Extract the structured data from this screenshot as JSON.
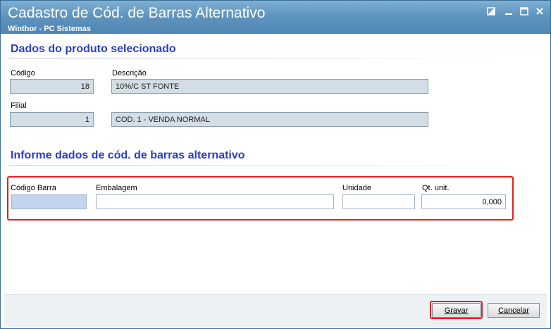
{
  "window": {
    "title": "Cadastro de Cód. de Barras Alternativo",
    "subtitle": "Winthor - PC Sistemas"
  },
  "product_section": {
    "heading": "Dados do produto selecionado",
    "codigo_label": "Código",
    "codigo_value": "18",
    "descricao_label": "Descrição",
    "descricao_value": "10%/C ST FONTE",
    "filial_label": "Filial",
    "filial_value": "1",
    "filial_desc_value": "COD. 1 - VENDA NORMAL"
  },
  "barcode_section": {
    "heading": "Informe dados de cód. de barras alternativo",
    "codigo_barra_label": "Código Barra",
    "codigo_barra_value": "",
    "embalagem_label": "Embalagem",
    "embalagem_value": "",
    "unidade_label": "Unidade",
    "unidade_value": "",
    "qt_unit_label": "Qt. unit.",
    "qt_unit_value": "0,000"
  },
  "footer": {
    "save_label": "Gravar",
    "cancel_label": "Cancelar"
  },
  "icons": {
    "restore": "restore-icon",
    "minimize": "minimize-icon",
    "maximize": "maximize-icon",
    "close": "close-icon"
  },
  "colors": {
    "titlebar": "#5f94bd",
    "section_heading": "#2b3ec4",
    "readonly_field": "#d3dde6",
    "highlight": "#e02020"
  }
}
